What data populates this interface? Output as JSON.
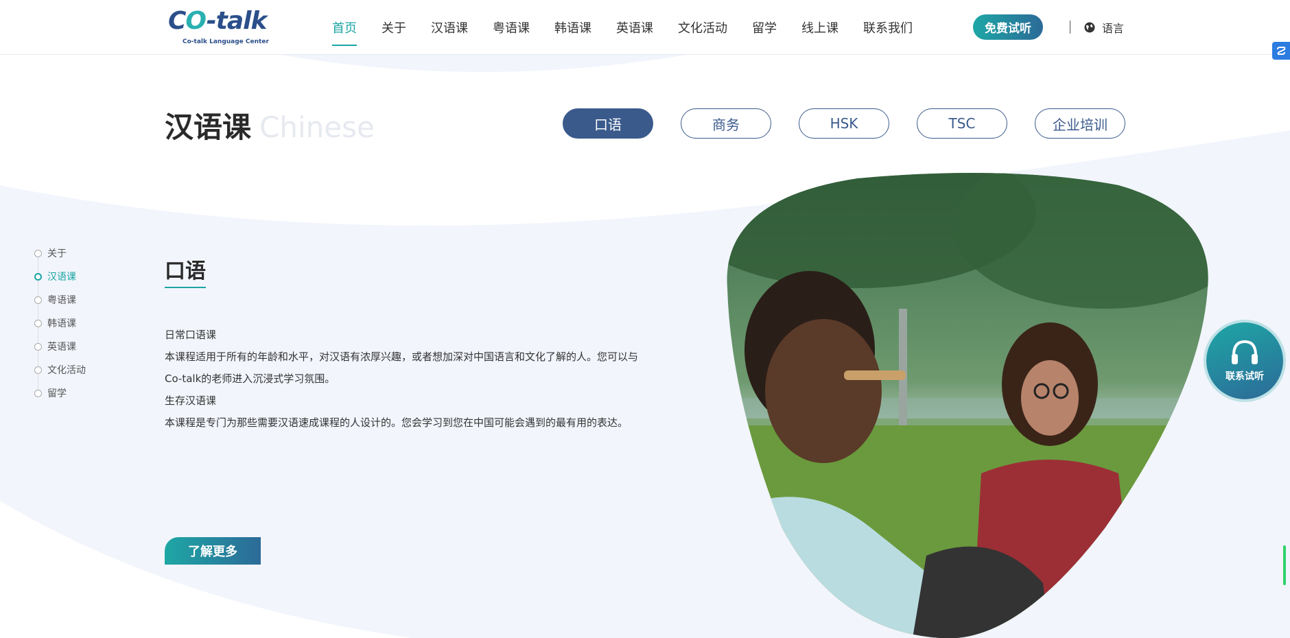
{
  "header": {
    "logo_text": "Co-talk",
    "logo_subtitle": "Co-talk Language Center",
    "nav": [
      {
        "label": "首页"
      },
      {
        "label": "关于"
      },
      {
        "label": "汉语课"
      },
      {
        "label": "粤语课"
      },
      {
        "label": "韩语课"
      },
      {
        "label": "英语课"
      },
      {
        "label": "文化活动"
      },
      {
        "label": "留学"
      },
      {
        "label": "线上课"
      },
      {
        "label": "联系我们"
      }
    ],
    "active_nav": "首页",
    "trial_button": "免费试听",
    "language_label": "语言"
  },
  "section": {
    "title": "汉语课",
    "title_en": "Chinese",
    "tabs": [
      {
        "label": "口语"
      },
      {
        "label": "商务"
      },
      {
        "label": "HSK"
      },
      {
        "label": "TSC"
      },
      {
        "label": "企业培训"
      }
    ],
    "active_tab": "口语"
  },
  "sidenav": {
    "items": [
      {
        "label": "关于"
      },
      {
        "label": "汉语课"
      },
      {
        "label": "粤语课"
      },
      {
        "label": "韩语课"
      },
      {
        "label": "英语课"
      },
      {
        "label": "文化活动"
      },
      {
        "label": "留学"
      }
    ],
    "active": "汉语课"
  },
  "content": {
    "title": "口语",
    "paragraphs": [
      "日常口语课",
      "本课程适用于所有的年龄和水平，对汉语有浓厚兴趣，或者想加深对中国语言和文化了解的人。您可以与Co-talk的老师进入沉浸式学习氛围。",
      "生存汉语课",
      "本课程是专门为那些需要汉语速成课程的人设计的。您会学习到您在中国可能会遇到的最有用的表达。"
    ],
    "more_button": "了解更多"
  },
  "float_contact": {
    "label": "联系试听",
    "icon": "headset-icon"
  },
  "colors": {
    "accent": "#1aa5a2",
    "navy": "#3a5a8c",
    "bg_light": "#f2f5fc"
  }
}
